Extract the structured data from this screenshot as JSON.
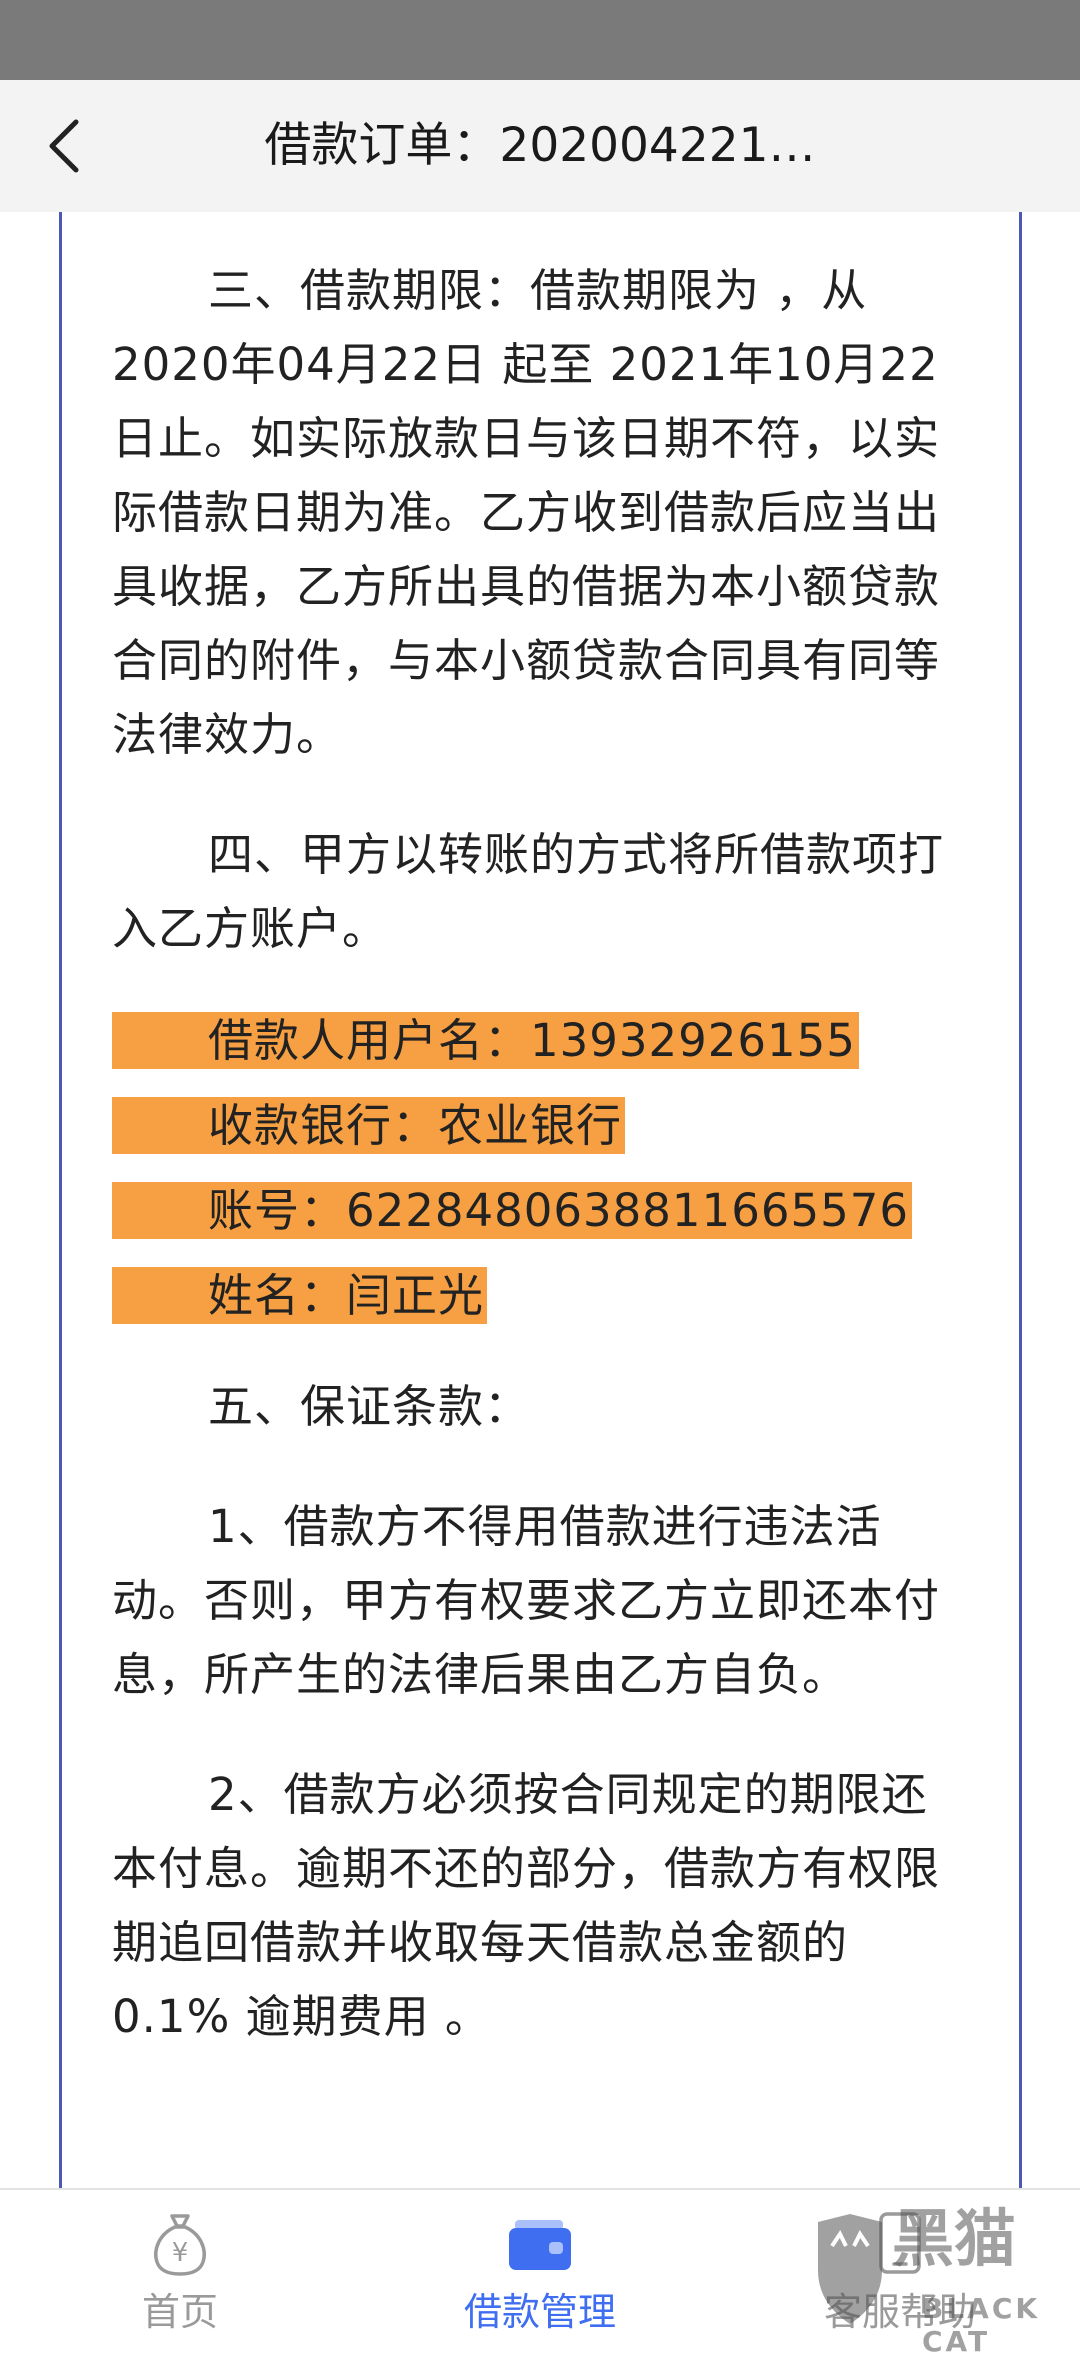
{
  "header": {
    "title": "借款订单：202004221…",
    "back_icon": "chevron-left-icon"
  },
  "document": {
    "clause3": "三、借款期限：借款期限为 ，从 2020年04月22日 起至  2021年10月22日止。如实际放款日与该日期不符，以实际借款日期为准。乙方收到借款后应当出具收据，乙方所出具的借据为本小额贷款合同的附件，与本小额贷款合同具有同等法律效力。",
    "clause4": "四、甲方以转账的方式将所借款项打入乙方账户。",
    "borrower_username": "借款人用户名：13932926155",
    "receiving_bank": "收款银行：农业银行",
    "account_number": "账号：6228480638811665576",
    "name": "姓名：闫正光",
    "clause5_title": "五、保证条款：",
    "clause5_1": "1、借款方不得用借款进行违法活动。否则，甲方有权要求乙方立即还本付息，所产生的法律后果由乙方自负。",
    "clause5_2": "2、借款方必须按合同规定的期限还本付息。逾期不还的部分，借款方有权限期追回借款并收取每天借款总金额的 0.1% 逾期费用 。",
    "highlight_color": "#f6a043",
    "border_color": "#4b58b4"
  },
  "tabs": {
    "home": {
      "label": "首页",
      "icon": "money-bag-icon"
    },
    "loan": {
      "label": "借款管理",
      "icon": "wallet-icon",
      "color": "#3f6ff0"
    },
    "help": {
      "label": "客服帮助",
      "icon": "phone-icon"
    }
  },
  "watermark": {
    "text": "黑猫",
    "subtext": "BLACK CAT"
  }
}
